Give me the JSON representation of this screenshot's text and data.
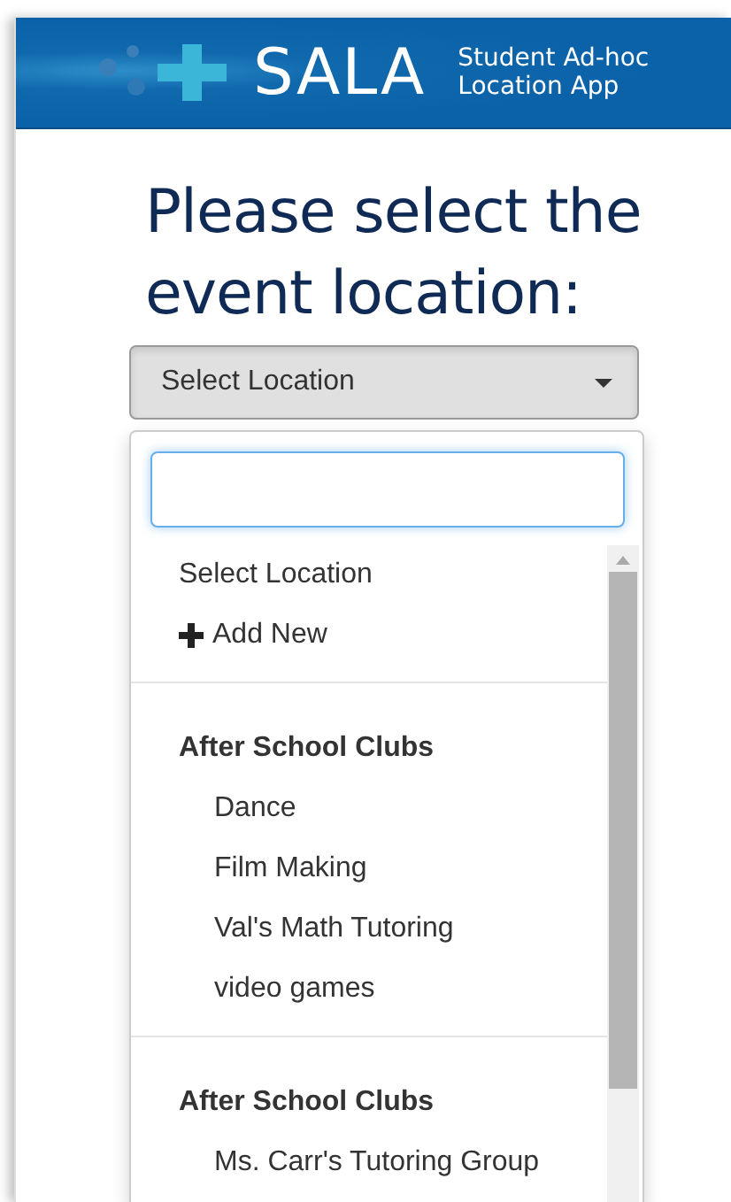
{
  "header": {
    "logo": "SALA",
    "tagline": [
      "Student Ad-hoc",
      "Location App"
    ]
  },
  "heading": "Please select the event location:",
  "select": {
    "value": "Select Location",
    "expanded": true
  },
  "items": [
    {
      "kind": "option",
      "label": "Select Location"
    },
    {
      "kind": "add",
      "label": "Add New"
    }
  ],
  "groups": [
    {
      "label": "After School Clubs",
      "options": [
        "Dance",
        "Film Making",
        "Val's Math Tutoring",
        "video games"
      ]
    },
    {
      "label": "After School Clubs",
      "options": [
        "Ms. Carr's Tutoring Group"
      ]
    }
  ]
}
